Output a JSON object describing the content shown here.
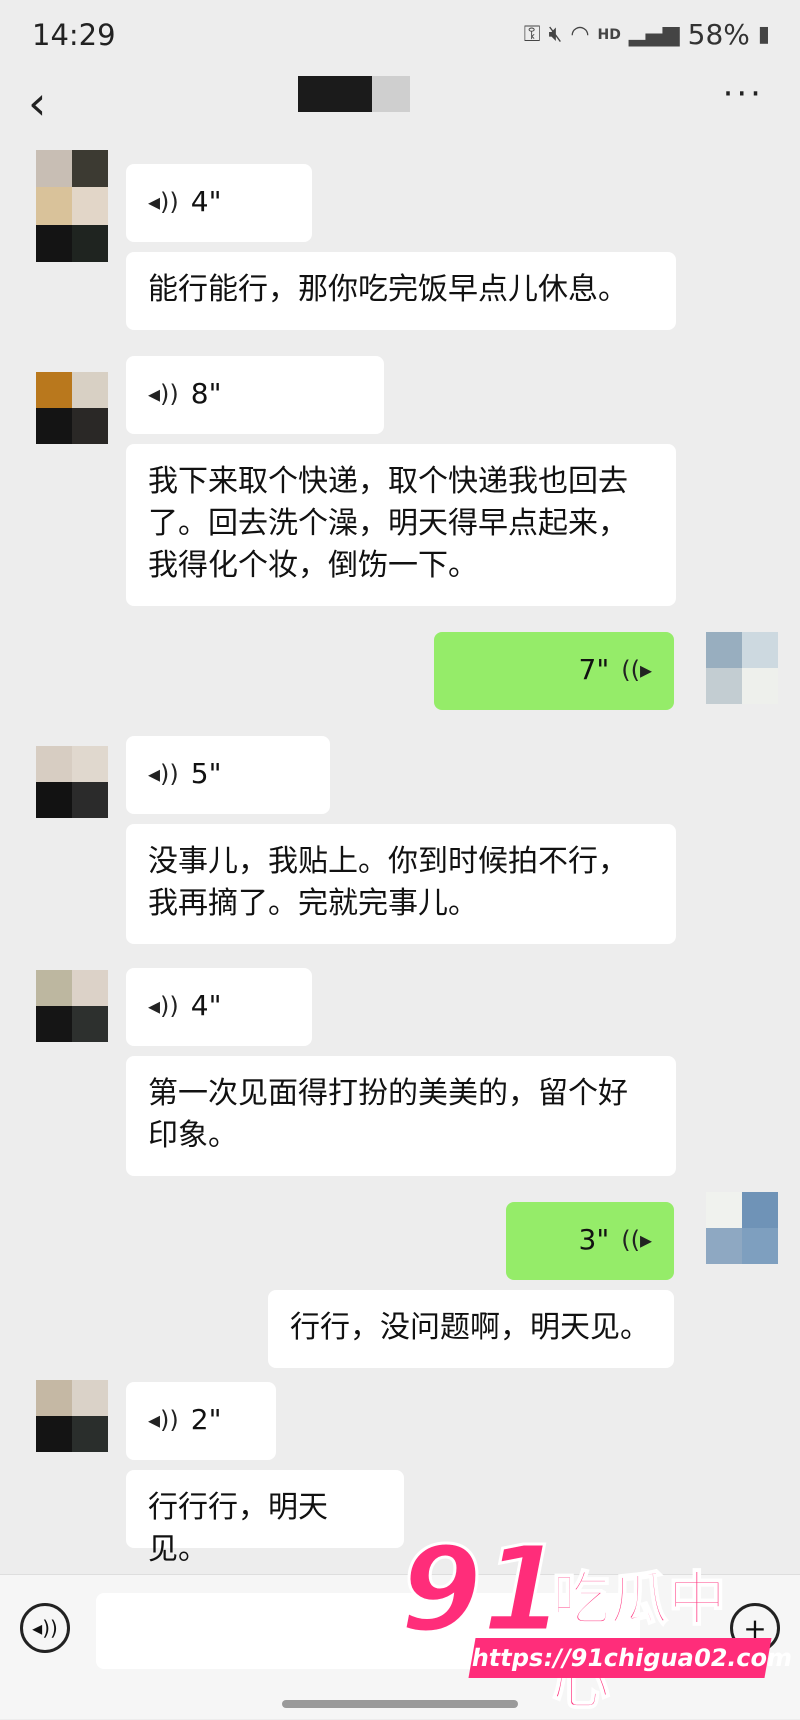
{
  "status_bar": {
    "time": "14:29",
    "battery": "58%",
    "network": "HD"
  },
  "nav": {
    "back_icon": "chevron-left-icon",
    "more_icon": "more-icon"
  },
  "messages": [
    {
      "side": "left",
      "type": "voice",
      "duration": "4\""
    },
    {
      "side": "left",
      "type": "text",
      "text": "能行能行，那你吃完饭早点儿休息。"
    },
    {
      "side": "left",
      "type": "voice",
      "duration": "8\""
    },
    {
      "side": "left",
      "type": "text",
      "lines": [
        "我下来取个快递，取个快递我也回去",
        "了。回去洗个澡，明天得早点起来，",
        "我得化个妆，倒饬一下。"
      ]
    },
    {
      "side": "right",
      "type": "voice",
      "duration": "7\""
    },
    {
      "side": "left",
      "type": "voice",
      "duration": "5\""
    },
    {
      "side": "left",
      "type": "text",
      "lines": [
        "没事儿，我贴上。你到时候拍不行，",
        "我再摘了。完就完事儿。"
      ]
    },
    {
      "side": "left",
      "type": "voice",
      "duration": "4\""
    },
    {
      "side": "left",
      "type": "text",
      "lines": [
        "第一次见面得打扮的美美的，留个好",
        "印象。"
      ]
    },
    {
      "side": "right",
      "type": "voice",
      "duration": "3\""
    },
    {
      "side": "right",
      "type": "text",
      "text": "行行，没问题啊，明天见。"
    },
    {
      "side": "left",
      "type": "voice",
      "duration": "2\""
    },
    {
      "side": "left",
      "type": "text",
      "text": "行行行，明天见。"
    }
  ],
  "watermark": {
    "num": "91",
    "text": "吃瓜中心",
    "url": "https://91chigua02.com"
  },
  "colors": {
    "background": "#ededed",
    "sent_bubble": "#95ec69",
    "received_bubble": "#ffffff",
    "watermark": "#ff2d7a"
  }
}
